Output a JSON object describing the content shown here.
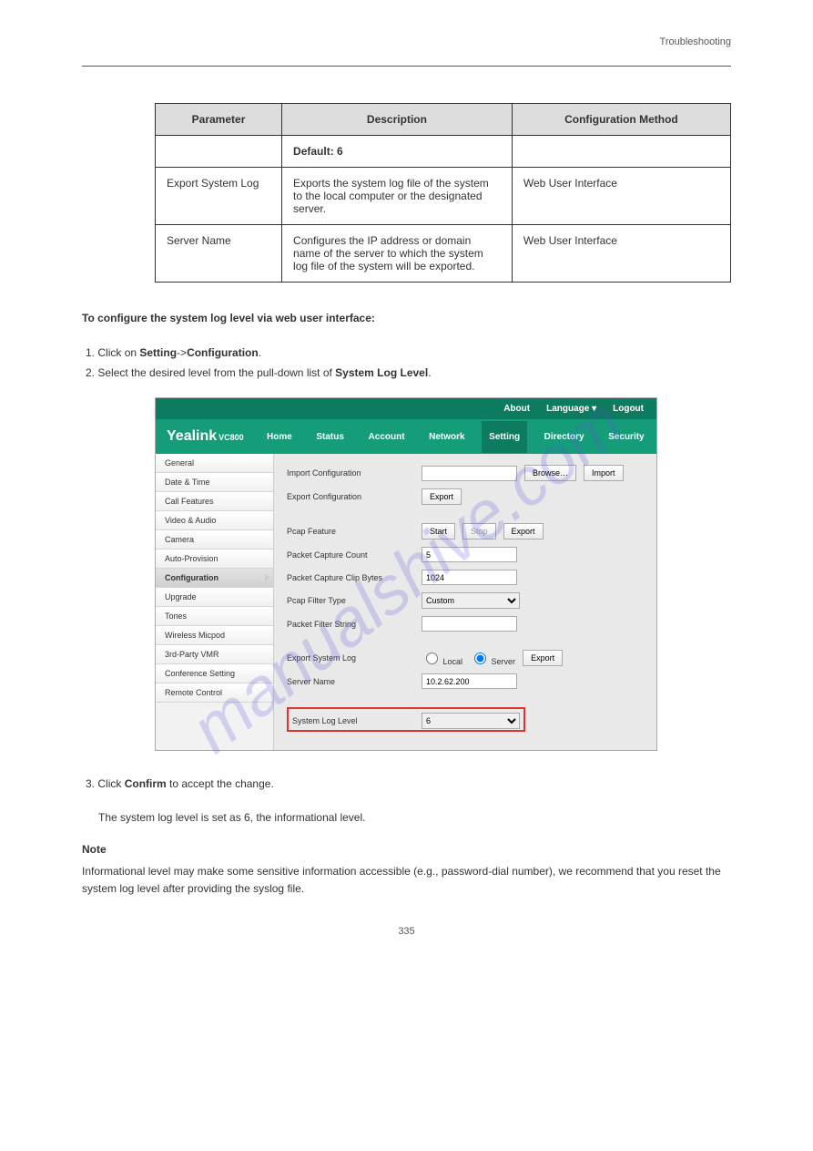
{
  "header": {
    "left": "",
    "right": "Troubleshooting"
  },
  "table": {
    "headers": [
      "Parameter",
      "Description",
      "Configuration Method"
    ],
    "rows": [
      [
        "",
        "Default: 6",
        ""
      ],
      [
        "Export System Log",
        "Exports the system log file of the system to the local computer or the designated server.",
        "Web User Interface"
      ],
      [
        "Server Name",
        "Configures the IP address or domain name of the server to which the system log file of the system will be exported.",
        "Web User Interface"
      ]
    ]
  },
  "intro": {
    "lead": "To configure the system log level via web user interface:",
    "steps": [
      {
        "prefix": "1.",
        "text_a": "Click on ",
        "bold_a": "Setting",
        "text_b": "->",
        "bold_b": "Configuration",
        "text_c": "."
      },
      {
        "prefix": "2.",
        "text_a": "Select the desired level from the pull-down list of ",
        "bold_a": "System Log Level",
        "text_b": "",
        "bold_b": "",
        "text_c": "."
      }
    ]
  },
  "ui": {
    "topbar": [
      "About",
      "Language ▾",
      "Logout"
    ],
    "logo": "Yealink",
    "model": "VC800",
    "nav": [
      {
        "label": "Home",
        "active": false
      },
      {
        "label": "Status",
        "active": false
      },
      {
        "label": "Account",
        "active": false
      },
      {
        "label": "Network",
        "active": false
      },
      {
        "label": "Setting",
        "active": true
      },
      {
        "label": "Directory",
        "active": false
      },
      {
        "label": "Security",
        "active": false
      }
    ],
    "sidebar": [
      {
        "label": "General",
        "active": false
      },
      {
        "label": "Date & Time",
        "active": false
      },
      {
        "label": "Call Features",
        "active": false
      },
      {
        "label": "Video & Audio",
        "active": false
      },
      {
        "label": "Camera",
        "active": false
      },
      {
        "label": "Auto-Provision",
        "active": false
      },
      {
        "label": "Configuration",
        "active": true
      },
      {
        "label": "Upgrade",
        "active": false
      },
      {
        "label": "Tones",
        "active": false
      },
      {
        "label": "Wireless Micpod",
        "active": false
      },
      {
        "label": "3rd-Party VMR",
        "active": false
      },
      {
        "label": "Conference Setting",
        "active": false
      },
      {
        "label": "Remote Control",
        "active": false
      }
    ],
    "fields": {
      "import_cfg_label": "Import Configuration",
      "export_cfg_label": "Export Configuration",
      "browse_btn": "Browse…",
      "import_btn": "Import",
      "export_btn": "Export",
      "pcap_feature_label": "Pcap Feature",
      "start_btn": "Start",
      "stop_btn": "Stop",
      "pcap_count_label": "Packet Capture Count",
      "pcap_count_value": "5",
      "pcap_clip_label": "Packet Capture Clip Bytes",
      "pcap_clip_value": "1024",
      "pcap_filter_type_label": "Pcap Filter Type",
      "pcap_filter_type_value": "Custom",
      "pcap_filter_string_label": "Packet Filter String",
      "pcap_filter_string_value": "",
      "export_syslog_label": "Export System Log",
      "local_radio": "Local",
      "server_radio": "Server",
      "server_name_label": "Server Name",
      "server_name_value": "10.2.62.200",
      "syslog_level_label": "System Log Level",
      "syslog_level_value": "6"
    }
  },
  "afterText": {
    "step3_prefix": "3.",
    "step3_a": "Click ",
    "step3_bold": "Confirm",
    "step3_b": " to accept the change.",
    "line2": "The system log level is set as 6, the informational level."
  },
  "note": {
    "label": "Note",
    "text": "Informational level may make some sensitive information accessible (e.g., password-dial number), we recommend that you reset the system log level after providing the syslog file."
  },
  "watermark": "manualshive.com",
  "page_number": "335"
}
